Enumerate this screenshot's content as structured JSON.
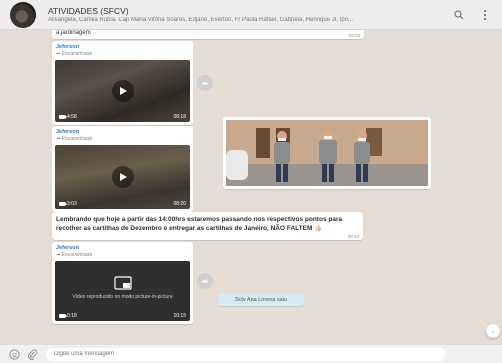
{
  "header": {
    "title": "ATIVIDADES (SFCV)",
    "subtitle": "Alisangela, Camila Rubia, Cap Maria Vitória Soares, Edjane, Everton, Fr Paula Rafael, Gabriela, Henrique JI, Ipo...",
    "icons": [
      "search-icon",
      "menu-icon"
    ]
  },
  "messages": {
    "top_partial": {
      "text": "a jardinagem",
      "time": "08:03"
    },
    "video1": {
      "sender": "Jeferson",
      "forwarded": "Encaminhada",
      "duration": "4:58",
      "time": "08:18"
    },
    "video2": {
      "sender": "Jeferson",
      "forwarded": "Encaminhada",
      "duration": "3:03",
      "time": "08:20"
    },
    "announcement": {
      "text": "Lembrando que hoje a partir das 14:00hrs estaremos passando nos respectivos pontos para recolher as cartilhas de Dezembro e entregar as cartilhas de Janeiro, NÃO FALTEM 👍🏻",
      "time": "08:52"
    },
    "video3": {
      "sender": "Jeferson",
      "forwarded": "Encaminhada",
      "overlay": "Vídeo reproduzido no modo picture-in-picture",
      "duration": "0:18",
      "time": "10:15"
    },
    "system": "Sctv Ana Lorena saiu"
  },
  "composer": {
    "placeholder": "Digite uma mensagem",
    "icons": [
      "emoji-icon",
      "attach-icon"
    ]
  },
  "colors": {
    "chat_bg": "#e5ddd5",
    "sender": "#1f7aec",
    "system_bubble": "#d4eaf4"
  }
}
